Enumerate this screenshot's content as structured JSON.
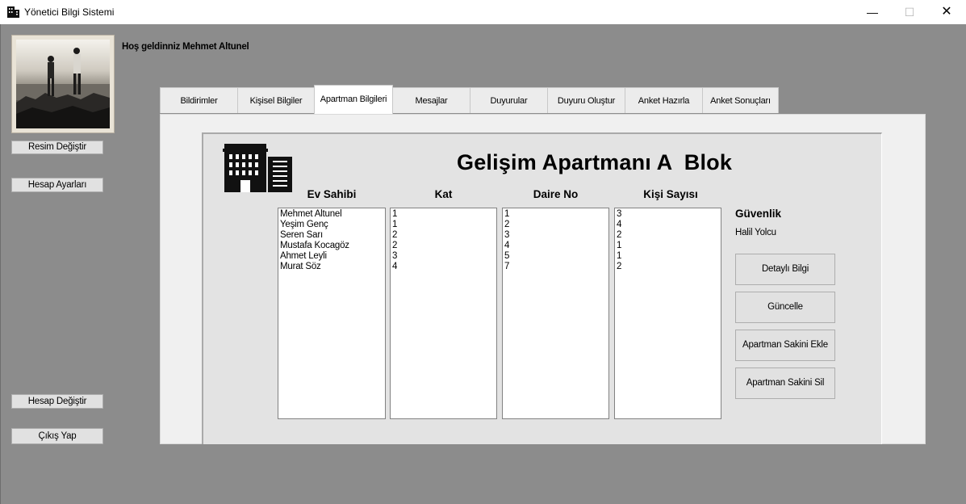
{
  "window": {
    "title": "Yönetici Bilgi Sistemi",
    "minimize_glyph": "—",
    "maximize_glyph": "☐",
    "close_glyph": "✕"
  },
  "sidebar": {
    "change_photo": "Resim Değiştir",
    "account_settings": "Hesap Ayarları",
    "switch_account": "Hesap Değiştir",
    "logout": "Çıkış Yap"
  },
  "welcome": "Hoş geldinniz Mehmet Altunel",
  "tabs": [
    {
      "label": "Bildirimler"
    },
    {
      "label": "Kişisel Bilgiler"
    },
    {
      "label": "Apartman Bilgileri",
      "active": true
    },
    {
      "label": "Mesajlar"
    },
    {
      "label": "Duyurular"
    },
    {
      "label": "Duyuru Oluştur"
    },
    {
      "label": "Anket Hazırla"
    },
    {
      "label": "Anket Sonuçları"
    }
  ],
  "building": {
    "title": "Gelişim Apartmanı A  Blok"
  },
  "columns": {
    "owner": "Ev Sahibi",
    "floor": "Kat",
    "apartment_no": "Daire No",
    "people": "Kişi Sayısı"
  },
  "residents": {
    "owners": [
      "Mehmet Altunel",
      "Yeşim Genç",
      "Seren Sarı",
      "Mustafa Kocagöz",
      "Ahmet Leyli",
      "Murat Söz"
    ],
    "floors": [
      "1",
      "1",
      "2",
      "2",
      "3",
      "4"
    ],
    "apartment_nos": [
      "1",
      "2",
      "3",
      "4",
      "5",
      "7"
    ],
    "people_counts": [
      "3",
      "4",
      "2",
      "1",
      "1",
      "2"
    ]
  },
  "security": {
    "label": "Güvenlik",
    "name": "Halil Yolcu"
  },
  "actions": {
    "details": "Detaylı Bilgi",
    "update": "Güncelle",
    "add_resident": "Apartman Sakini Ekle",
    "remove_resident": "Apartman Sakini Sil"
  }
}
